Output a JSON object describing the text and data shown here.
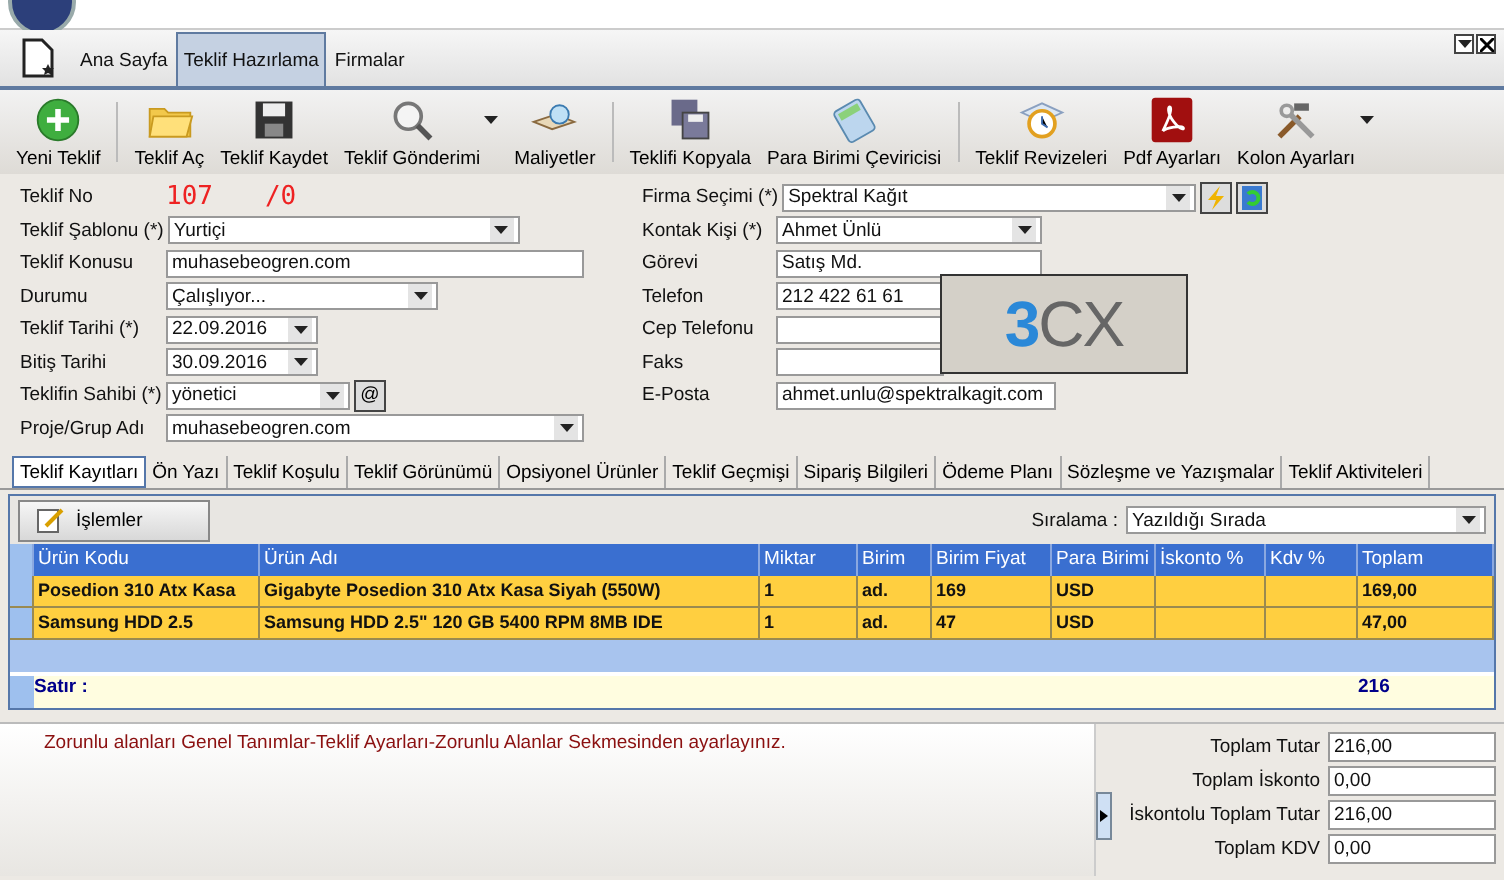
{
  "ribbon_tabs": [
    {
      "label": "Ana Sayfa",
      "selected": false
    },
    {
      "label": "Teklif Hazırlama",
      "selected": true
    },
    {
      "label": "Firmalar",
      "selected": false
    }
  ],
  "toolbar": [
    {
      "label": "Yeni Teklif",
      "separator_before": false,
      "menu": false
    },
    {
      "label": "Teklif Aç",
      "separator_before": true,
      "menu": false
    },
    {
      "label": "Teklif Kaydet",
      "separator_before": false,
      "menu": false
    },
    {
      "label": "Teklif Gönderimi",
      "separator_before": false,
      "menu": true
    },
    {
      "label": "Maliyetler",
      "separator_before": false,
      "menu": false
    },
    {
      "label": "Teklifi Kopyala",
      "separator_before": true,
      "menu": false
    },
    {
      "label": "Para Birimi Çeviricisi",
      "separator_before": false,
      "menu": false
    },
    {
      "label": "Teklif Revizeleri",
      "separator_before": true,
      "menu": false
    },
    {
      "label": "Pdf Ayarları",
      "separator_before": false,
      "menu": false
    },
    {
      "label": "Kolon Ayarları",
      "separator_before": false,
      "menu": true
    }
  ],
  "form_left": [
    {
      "label": "Teklif No",
      "kind": "number",
      "value": "107",
      "revision": "/0"
    },
    {
      "label": "Teklif Şablonu (*)",
      "kind": "combo",
      "value": "Yurtiçi"
    },
    {
      "label": "Teklif Konusu",
      "kind": "text",
      "value": "muhasebeogren.com"
    },
    {
      "label": "Durumu",
      "kind": "combo",
      "value": "Çalışlıyor..."
    },
    {
      "label": "Teklif Tarihi (*)",
      "kind": "combo",
      "value": "22.09.2016"
    },
    {
      "label": "Bitiş Tarihi",
      "kind": "combo",
      "value": "30.09.2016"
    },
    {
      "label": "Teklifin Sahibi (*)",
      "kind": "combo",
      "value": "yönetici",
      "button": "@"
    },
    {
      "label": "Proje/Grup Adı",
      "kind": "combo",
      "value": "muhasebeogren.com"
    }
  ],
  "form_right": [
    {
      "label": "Firma Seçimi (*)",
      "kind": "combo",
      "value": "Spektral Kağıt",
      "actions": true
    },
    {
      "label": "Kontak Kişi (*)",
      "kind": "combo",
      "value": "Ahmet Ünlü"
    },
    {
      "label": "Görevi",
      "kind": "text",
      "value": "Satış Md."
    },
    {
      "label": "Telefon",
      "kind": "text",
      "value": "212 422 61 61"
    },
    {
      "label": "Cep Telefonu",
      "kind": "text"
    },
    {
      "label": "Faks",
      "kind": "text"
    },
    {
      "label": "E-Posta",
      "kind": "text",
      "value": "ahmet.unlu@spektralkagit.com"
    }
  ],
  "phone_logo": "3CX",
  "detail_tabs": [
    {
      "label": "Teklif Kayıtları",
      "selected": true
    },
    {
      "label": "Ön Yazı",
      "selected": false
    },
    {
      "label": "Teklif Koşulu",
      "selected": false
    },
    {
      "label": "Teklif Görünümü",
      "selected": false
    },
    {
      "label": "Opsiyonel Ürünler",
      "selected": false
    },
    {
      "label": "Teklif Geçmişi",
      "selected": false
    },
    {
      "label": "Sipariş Bilgileri",
      "selected": false
    },
    {
      "label": "Ödeme Planı",
      "selected": false
    },
    {
      "label": "Sözleşme ve Yazışmalar",
      "selected": false
    },
    {
      "label": "Teklif Aktiviteleri",
      "selected": false
    }
  ],
  "actions_button": "İşlemler",
  "sort": {
    "label": "Sıralama :",
    "value": "Yazıldığı Sırada"
  },
  "table": {
    "columns": [
      "Ürün Kodu",
      "Ürün Adı",
      "Miktar",
      "Birim",
      "Birim Fiyat",
      "Para Birimi",
      "İskonto %",
      "Kdv %",
      "Toplam"
    ],
    "rows": [
      [
        "Posedion 310 Atx Kasa",
        "Gigabyte Posedion 310 Atx Kasa Siyah (550W)",
        "1",
        "ad.",
        "169",
        "USD",
        null,
        null,
        "169,00"
      ],
      [
        "Samsung HDD 2.5",
        "Samsung HDD 2.5\" 120 GB 5400 RPM 8MB IDE",
        "1",
        "ad.",
        "47",
        "USD",
        null,
        null,
        "47,00"
      ]
    ],
    "footer_label": "Satır :",
    "footer_total": "216"
  },
  "message": "Zorunlu alanları Genel Tanımlar-Teklif Ayarları-Zorunlu Alanlar Sekmesinden ayarlayınız.",
  "totals": [
    {
      "label": "Toplam Tutar",
      "value": "216,00"
    },
    {
      "label": "Toplam İskonto",
      "value": "0,00"
    },
    {
      "label": "İskontolu Toplam Tutar",
      "value": "216,00"
    },
    {
      "label": "Toplam KDV",
      "value": "0,00"
    }
  ]
}
